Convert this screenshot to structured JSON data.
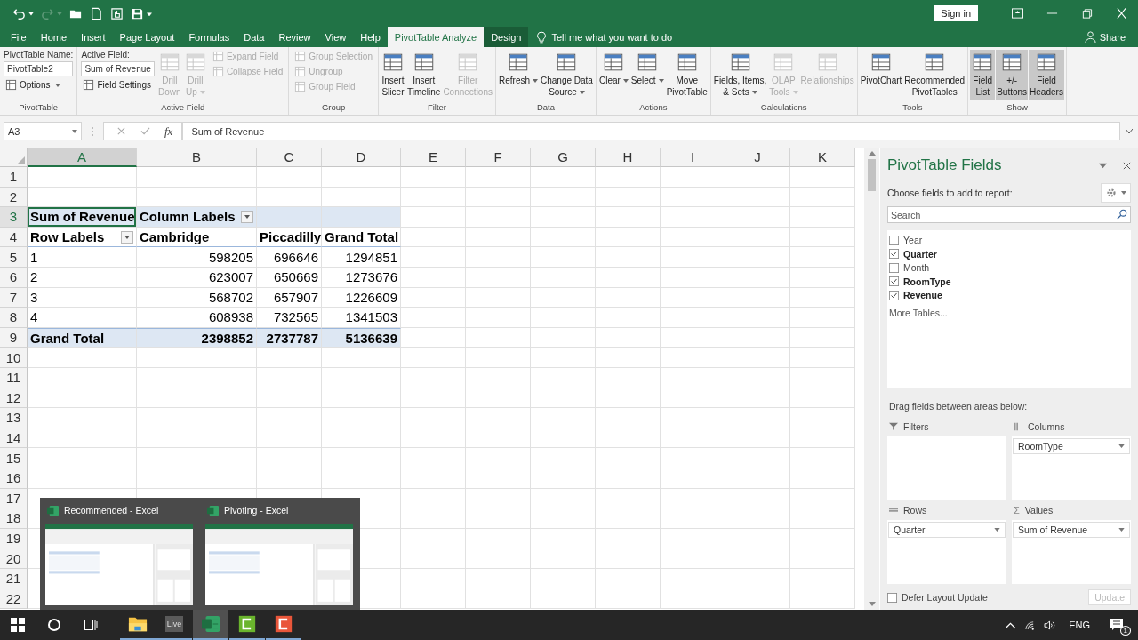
{
  "window": {
    "sign_in": "Sign in"
  },
  "tabs": [
    {
      "label": "File",
      "selected": false,
      "kind": "normal"
    },
    {
      "label": "Home",
      "selected": false,
      "kind": "normal"
    },
    {
      "label": "Insert",
      "selected": false,
      "kind": "normal"
    },
    {
      "label": "Page Layout",
      "selected": false,
      "kind": "normal"
    },
    {
      "label": "Formulas",
      "selected": false,
      "kind": "normal"
    },
    {
      "label": "Data",
      "selected": false,
      "kind": "normal"
    },
    {
      "label": "Review",
      "selected": false,
      "kind": "normal"
    },
    {
      "label": "View",
      "selected": false,
      "kind": "normal"
    },
    {
      "label": "Help",
      "selected": false,
      "kind": "normal"
    },
    {
      "label": "PivotTable Analyze",
      "selected": true,
      "kind": "contextual"
    },
    {
      "label": "Design",
      "selected": false,
      "kind": "contextual"
    }
  ],
  "tell_me": "Tell me what you want to do",
  "share": "Share",
  "ribbon_groups": [
    {
      "label": "PivotTable",
      "columns": [
        {
          "kind": "stack",
          "items": [
            {
              "kind": "caption",
              "text": "PivotTable Name:"
            },
            {
              "kind": "field",
              "value": "PivotTable2"
            },
            {
              "kind": "small",
              "label": "Options",
              "disabled": false,
              "dropdown": true
            }
          ]
        }
      ]
    },
    {
      "label": "Active Field",
      "columns": [
        {
          "kind": "stack",
          "items": [
            {
              "kind": "caption",
              "text": "Active Field:"
            },
            {
              "kind": "field",
              "value": "Sum of Revenue"
            },
            {
              "kind": "small",
              "label": "Field Settings",
              "disabled": false
            }
          ]
        },
        {
          "kind": "large",
          "lines": [
            "Drill",
            "Down"
          ],
          "disabled": true
        },
        {
          "kind": "large",
          "lines": [
            "Drill",
            "Up"
          ],
          "disabled": true,
          "dropdown": true
        },
        {
          "kind": "stack",
          "items": [
            {
              "kind": "small",
              "label": "Expand Field",
              "disabled": true
            },
            {
              "kind": "small",
              "label": "Collapse Field",
              "disabled": true
            }
          ]
        }
      ]
    },
    {
      "label": "Group",
      "columns": [
        {
          "kind": "stack",
          "items": [
            {
              "kind": "small",
              "label": "Group Selection",
              "disabled": true
            },
            {
              "kind": "small",
              "label": "Ungroup",
              "disabled": true
            },
            {
              "kind": "small",
              "label": "Group Field",
              "disabled": true
            }
          ]
        }
      ]
    },
    {
      "label": "Filter",
      "columns": [
        {
          "kind": "large",
          "lines": [
            "Insert",
            "Slicer"
          ],
          "disabled": false
        },
        {
          "kind": "large",
          "lines": [
            "Insert",
            "Timeline"
          ],
          "disabled": false
        },
        {
          "kind": "large",
          "lines": [
            "Filter",
            "Connections"
          ],
          "disabled": true
        }
      ]
    },
    {
      "label": "Data",
      "columns": [
        {
          "kind": "large",
          "lines": [
            "Refresh"
          ],
          "disabled": false,
          "dropdown": true
        },
        {
          "kind": "large",
          "lines": [
            "Change Data",
            "Source"
          ],
          "disabled": false,
          "dropdown": true
        }
      ]
    },
    {
      "label": "Actions",
      "columns": [
        {
          "kind": "large",
          "lines": [
            "Clear"
          ],
          "disabled": false,
          "dropdown": true
        },
        {
          "kind": "large",
          "lines": [
            "Select"
          ],
          "disabled": false,
          "dropdown": true
        },
        {
          "kind": "large",
          "lines": [
            "Move",
            "PivotTable"
          ],
          "disabled": false
        }
      ]
    },
    {
      "label": "Calculations",
      "columns": [
        {
          "kind": "large",
          "lines": [
            "Fields, Items,",
            "& Sets"
          ],
          "disabled": false,
          "dropdown": true
        },
        {
          "kind": "large",
          "lines": [
            "OLAP",
            "Tools"
          ],
          "disabled": true,
          "dropdown": true
        },
        {
          "kind": "large",
          "lines": [
            "Relationships"
          ],
          "disabled": true
        }
      ]
    },
    {
      "label": "Tools",
      "columns": [
        {
          "kind": "large",
          "lines": [
            "PivotChart"
          ],
          "disabled": false
        },
        {
          "kind": "large",
          "lines": [
            "Recommended",
            "PivotTables"
          ],
          "disabled": false
        }
      ]
    },
    {
      "label": "Show",
      "columns": [
        {
          "kind": "large",
          "lines": [
            "Field",
            "List"
          ],
          "disabled": false,
          "on": true
        },
        {
          "kind": "large",
          "lines": [
            "+/-",
            "Buttons"
          ],
          "disabled": false,
          "on": true
        },
        {
          "kind": "large",
          "lines": [
            "Field",
            "Headers"
          ],
          "disabled": false,
          "on": true
        }
      ]
    }
  ],
  "formula_bar": {
    "name_box": "A3",
    "function_label": "fx",
    "value": "Sum of Revenue"
  },
  "sheet": {
    "columns": [
      {
        "label": "A",
        "selected": true
      },
      {
        "label": "B",
        "selected": false
      },
      {
        "label": "C",
        "selected": false
      },
      {
        "label": "D",
        "selected": false
      },
      {
        "label": "E",
        "selected": false
      },
      {
        "label": "F",
        "selected": false
      },
      {
        "label": "G",
        "selected": false
      },
      {
        "label": "H",
        "selected": false
      },
      {
        "label": "I",
        "selected": false
      },
      {
        "label": "J",
        "selected": false
      },
      {
        "label": "K",
        "selected": false
      }
    ],
    "rows": [
      {
        "label": "1",
        "selected": false
      },
      {
        "label": "2",
        "selected": false
      },
      {
        "label": "3",
        "selected": true
      },
      {
        "label": "4",
        "selected": false
      },
      {
        "label": "5",
        "selected": false
      },
      {
        "label": "6",
        "selected": false
      },
      {
        "label": "7",
        "selected": false
      },
      {
        "label": "8",
        "selected": false
      },
      {
        "label": "9",
        "selected": false
      },
      {
        "label": "10",
        "selected": false
      },
      {
        "label": "11",
        "selected": false
      },
      {
        "label": "12",
        "selected": false
      },
      {
        "label": "13",
        "selected": false
      },
      {
        "label": "14",
        "selected": false
      },
      {
        "label": "15",
        "selected": false
      },
      {
        "label": "16",
        "selected": false
      },
      {
        "label": "17",
        "selected": false
      },
      {
        "label": "18",
        "selected": false
      },
      {
        "label": "19",
        "selected": false
      },
      {
        "label": "20",
        "selected": false
      },
      {
        "label": "21",
        "selected": false
      },
      {
        "label": "22",
        "selected": false
      }
    ],
    "pivot": [
      {
        "kind": "labels",
        "cells": [
          {
            "text": "Sum of Revenue",
            "selected": true
          },
          {
            "text": "Column Labels",
            "selected": false,
            "filter": true
          }
        ]
      },
      {
        "kind": "header",
        "cells": [
          {
            "text": "Row Labels",
            "selected": false,
            "filter": true
          },
          {
            "text": "Cambridge",
            "selected": false
          },
          {
            "text": "Piccadilly",
            "selected": false
          },
          {
            "text": "Grand Total",
            "selected": false
          }
        ]
      },
      {
        "kind": "data",
        "cells": [
          {
            "text": "1",
            "selected": false
          },
          {
            "text": "598205",
            "selected": false
          },
          {
            "text": "696646",
            "selected": false
          },
          {
            "text": "1294851",
            "selected": false
          }
        ]
      },
      {
        "kind": "data",
        "cells": [
          {
            "text": "2",
            "selected": false
          },
          {
            "text": "623007",
            "selected": false
          },
          {
            "text": "650669",
            "selected": false
          },
          {
            "text": "1273676",
            "selected": false
          }
        ]
      },
      {
        "kind": "data",
        "cells": [
          {
            "text": "3",
            "selected": false
          },
          {
            "text": "568702",
            "selected": false
          },
          {
            "text": "657907",
            "selected": false
          },
          {
            "text": "1226609",
            "selected": false
          }
        ]
      },
      {
        "kind": "data",
        "cells": [
          {
            "text": "4",
            "selected": false
          },
          {
            "text": "608938",
            "selected": false
          },
          {
            "text": "732565",
            "selected": false
          },
          {
            "text": "1341503",
            "selected": false
          }
        ]
      },
      {
        "kind": "total",
        "cells": [
          {
            "text": "Grand Total",
            "selected": false
          },
          {
            "text": "2398852",
            "selected": false
          },
          {
            "text": "2737787",
            "selected": false
          },
          {
            "text": "5136639",
            "selected": false
          }
        ]
      }
    ]
  },
  "thumbnails": [
    {
      "title": "Recommended - Excel"
    },
    {
      "title": "Pivoting - Excel"
    }
  ],
  "panel": {
    "title": "PivotTable Fields",
    "subtitle": "Choose fields to add to report:",
    "search": {
      "placeholder": "Search"
    },
    "fields": [
      {
        "label": "Year",
        "checked": false
      },
      {
        "label": "Quarter",
        "checked": true
      },
      {
        "label": "Month",
        "checked": false
      },
      {
        "label": "RoomType",
        "checked": true
      },
      {
        "label": "Revenue",
        "checked": true
      }
    ],
    "more_tables": "More Tables...",
    "areas_hint": "Drag fields between areas below:",
    "areas": [
      {
        "kind": "filters",
        "label": "Filters"
      },
      {
        "kind": "columns",
        "label": "Columns",
        "items": [
          "RoomType"
        ]
      },
      {
        "kind": "rows",
        "label": "Rows",
        "items": [
          "Quarter"
        ]
      },
      {
        "kind": "values",
        "label": "Values",
        "symbol": "Σ",
        "items": [
          "Sum of Revenue"
        ]
      }
    ],
    "defer": {
      "label": "Defer Layout Update",
      "checked": false
    },
    "update_button": {
      "label": "Update",
      "disabled": true
    }
  },
  "taskbar": {
    "apps": [
      {
        "kind": "explorer",
        "selected": false
      },
      {
        "kind": "live",
        "label": "Live",
        "selected": false
      },
      {
        "kind": "excel",
        "selected": true
      },
      {
        "kind": "camtasia-green",
        "selected": false
      },
      {
        "kind": "camtasia-orange",
        "selected": false
      }
    ],
    "language": "ENG",
    "notifications": "1"
  }
}
